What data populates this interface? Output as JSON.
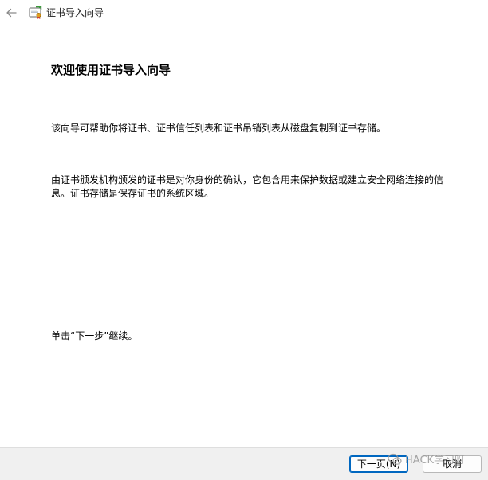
{
  "window": {
    "title": "证书导入向导"
  },
  "icons": {
    "back": "arrow-left-icon",
    "app": "certificate-icon"
  },
  "main": {
    "heading": "欢迎使用证书导入向导",
    "paragraph1": "该向导可帮助你将证书、证书信任列表和证书吊销列表从磁盘复制到证书存储。",
    "paragraph2": "由证书颁发机构颁发的证书是对你身份的确认，它包含用来保护数据或建立安全网络连接的信息。证书存储是保存证书的系统区域。",
    "paragraph3": "单击“下一步”继续。"
  },
  "footer": {
    "next_label": "下一页(N)",
    "cancel_label": "取消"
  },
  "watermark": {
    "text": "HACK学习呀"
  },
  "colors": {
    "accent": "#0067c0",
    "footer_bg": "#f0f0f0"
  }
}
